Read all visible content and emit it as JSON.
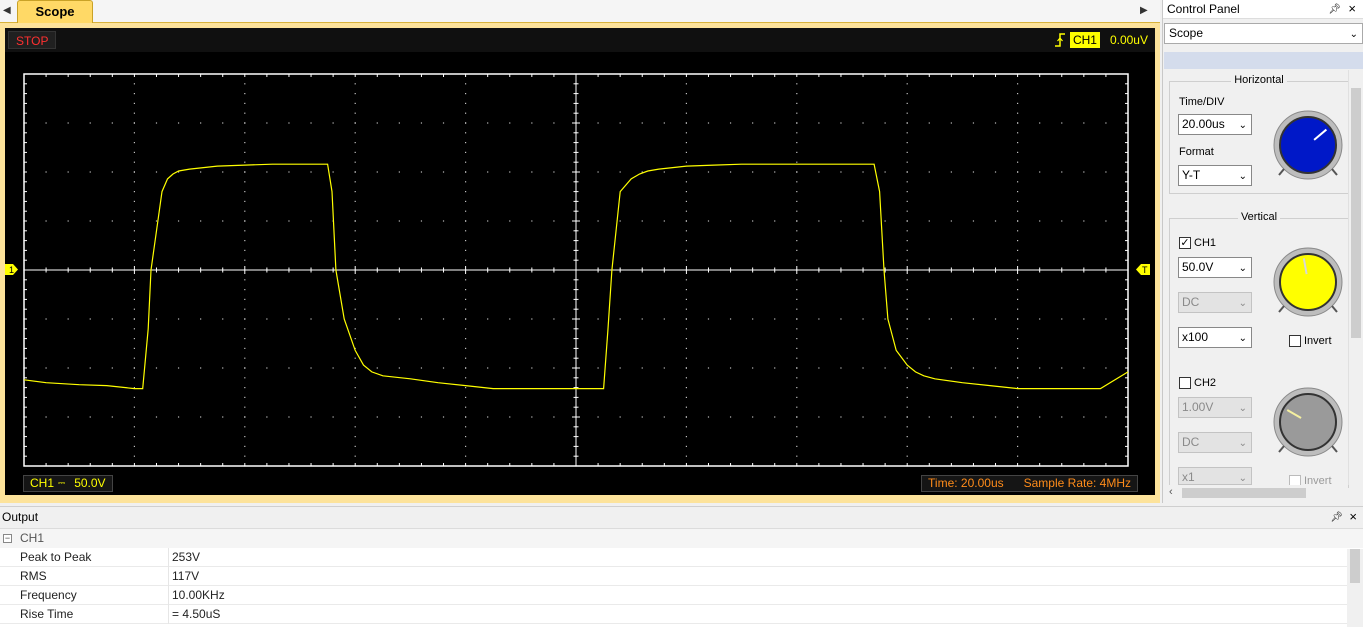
{
  "tabs": [
    {
      "label": "Scope",
      "active": true
    }
  ],
  "scope": {
    "run_state": "STOP",
    "trigger": {
      "channel": "CH1",
      "level": "0.00uV"
    },
    "channel_marker": "1",
    "trigger_marker": "T",
    "ch1_scale": {
      "channel": "CH1",
      "coupling_icon": "dc-coupling-icon",
      "value": "50.0V"
    },
    "time_label": "Time: 20.00us",
    "sample_rate_label": "Sample Rate: 4MHz",
    "colors": {
      "trace": "#ffff00",
      "grid": "#ffffff",
      "border": "#ffffff",
      "status_orange": "#ff8c1a",
      "stop_red": "#ff3030"
    }
  },
  "control_panel": {
    "title": "Control Panel",
    "mode": "Scope",
    "horizontal": {
      "title": "Horizontal",
      "time_div_label": "Time/DIV",
      "time_div_value": "20.00us",
      "format_label": "Format",
      "format_value": "Y-T",
      "knob_color": "#0018c8"
    },
    "vertical": {
      "title": "Vertical",
      "ch1": {
        "label": "CH1",
        "checked": true,
        "volts": "50.0V",
        "coupling": "DC",
        "probe": "x100",
        "invert_label": "Invert",
        "invert_checked": false,
        "knob_color": "#ffff00"
      },
      "ch2": {
        "label": "CH2",
        "checked": false,
        "volts": "1.00V",
        "coupling": "DC",
        "probe": "x1",
        "invert_label": "Invert",
        "invert_checked": false,
        "knob_color": "#9a9a9a"
      }
    }
  },
  "output": {
    "title": "Output",
    "group": "CH1",
    "rows": [
      {
        "key": "Peak to Peak",
        "value": "253V"
      },
      {
        "key": "RMS",
        "value": "117V"
      },
      {
        "key": "Frequency",
        "value": "10.00KHz"
      },
      {
        "key": "Rise Time",
        "value": "= 4.50uS"
      }
    ]
  },
  "chart_data": {
    "type": "line",
    "x_unit": "us",
    "y_unit": "V",
    "xlim": [
      -100,
      100
    ],
    "ylim": [
      -200,
      200
    ],
    "x_divisions": 10,
    "y_divisions": 8,
    "grid": true,
    "series": [
      {
        "color": "#ffff00",
        "x": [
          -100,
          -96,
          -90,
          -85,
          -80,
          -78.5,
          -77.5,
          -77,
          -75,
          -74,
          -73,
          -72,
          -70,
          -65,
          -60,
          -55,
          -50,
          -46,
          -45,
          -44.2,
          -43.5,
          -42,
          -40,
          -38.5,
          -37,
          -35,
          -30,
          -25,
          -20,
          -15,
          -10,
          -5,
          0,
          4,
          5,
          5.8,
          6.5,
          8,
          10,
          11.5,
          13,
          15,
          20,
          25,
          30,
          35,
          40,
          45,
          50,
          54,
          55,
          55.8,
          56.5,
          58,
          60,
          61.5,
          63,
          65,
          70,
          75,
          80,
          85,
          90,
          95,
          100
        ],
        "y": [
          -112,
          -115,
          -117,
          -118,
          -121,
          -121,
          -60,
          0,
          80,
          93,
          98,
          101,
          103,
          106,
          107,
          108,
          108,
          108,
          108,
          80,
          0,
          -50,
          -82,
          -97,
          -104,
          -108,
          -111,
          -115,
          -118,
          -121,
          -121,
          -121,
          -121,
          -121,
          -121,
          -60,
          0,
          80,
          93,
          98,
          101,
          103,
          106,
          107,
          108,
          108,
          108,
          108,
          108,
          108,
          80,
          0,
          -50,
          -82,
          -97,
          -104,
          -108,
          -111,
          -115,
          -118,
          -121,
          -121,
          -121,
          -121,
          -104
        ]
      }
    ]
  }
}
